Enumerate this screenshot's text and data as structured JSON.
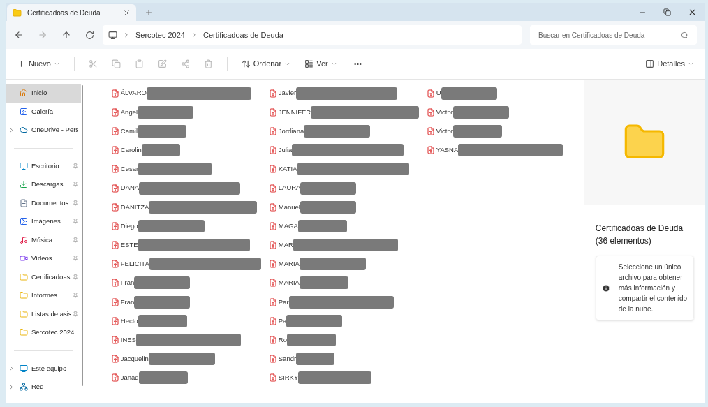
{
  "tab": {
    "title": "Certificadoas de Deuda",
    "selected": true
  },
  "breadcrumb": [
    "Sercotec 2024",
    "Certificadoas de Deuda"
  ],
  "search": {
    "placeholder": "Buscar en Certificadoas de Deuda"
  },
  "toolbar": {
    "new": "Nuevo",
    "sort": "Ordenar",
    "view": "Ver",
    "more": "•••",
    "details": "Detalles"
  },
  "sidebar": [
    {
      "label": "Inicio",
      "kind": "home",
      "selected": true,
      "expandable": false,
      "pinned": false
    },
    {
      "label": "Galería",
      "kind": "gallery",
      "selected": false,
      "expandable": false,
      "pinned": false
    },
    {
      "label": "OneDrive - Pers",
      "kind": "cloud",
      "selected": false,
      "expandable": true,
      "pinned": false
    },
    {
      "kind": "divider"
    },
    {
      "label": "Escritorio",
      "kind": "desktop",
      "selected": false,
      "expandable": false,
      "pinned": true
    },
    {
      "label": "Descargas",
      "kind": "download",
      "selected": false,
      "expandable": false,
      "pinned": true
    },
    {
      "label": "Documentos",
      "kind": "document",
      "selected": false,
      "expandable": false,
      "pinned": true
    },
    {
      "label": "Imágenes",
      "kind": "image",
      "selected": false,
      "expandable": false,
      "pinned": true
    },
    {
      "label": "Música",
      "kind": "music",
      "selected": false,
      "expandable": false,
      "pinned": true
    },
    {
      "label": "Vídeos",
      "kind": "video",
      "selected": false,
      "expandable": false,
      "pinned": true
    },
    {
      "label": "Certificadoas",
      "kind": "folder",
      "selected": false,
      "expandable": false,
      "pinned": true
    },
    {
      "label": "Informes",
      "kind": "folder",
      "selected": false,
      "expandable": false,
      "pinned": true
    },
    {
      "label": "Listas de asis",
      "kind": "folder",
      "selected": false,
      "expandable": false,
      "pinned": true
    },
    {
      "label": "Sercotec 2024",
      "kind": "folder",
      "selected": false,
      "expandable": false,
      "pinned": false
    },
    {
      "kind": "divider"
    },
    {
      "label": "Este equipo",
      "kind": "pc",
      "selected": false,
      "expandable": true,
      "pinned": false
    },
    {
      "label": "Red",
      "kind": "network",
      "selected": false,
      "expandable": true,
      "pinned": false
    }
  ],
  "files": [
    [
      "ÁLVARO",
      "Angel",
      "Camil",
      "Carolin",
      "Cesar",
      "DANA",
      "DANITZA",
      "Diego",
      "ESTE",
      "FELICITA",
      "Fran",
      "Fran",
      "Hecto",
      "INES",
      "Jacquelin",
      "Janad"
    ],
    [
      "Javier",
      "JENNIFER",
      "Jordiana",
      "Julia",
      "KATIA",
      "LAURA",
      "Manuel",
      "MAGA",
      "MAR",
      "MARIA",
      "MARIA",
      "Par",
      "Pa",
      "Ro",
      "Sandr",
      "SIRKY"
    ],
    [
      "U",
      "Victor",
      "Victor",
      "YASNA"
    ]
  ],
  "details": {
    "title": "Certificadoas de Deuda (36 elementos)",
    "info": "Seleccione un único archivo para obtener más información y compartir el contenido de la nube."
  }
}
